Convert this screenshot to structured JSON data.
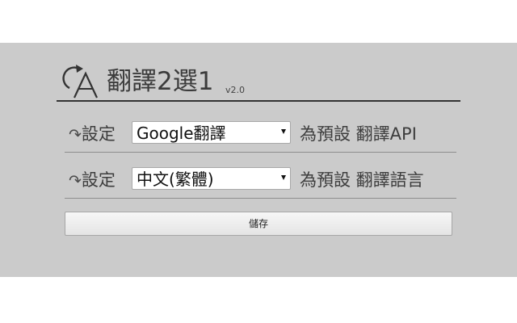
{
  "header": {
    "title": "翻譯2選1",
    "version": "v2.0",
    "logo_icon": "rotate-translate-logo"
  },
  "settings": [
    {
      "arrow": "↷",
      "prefix": "設定",
      "selected_value": "Google翻譯",
      "suffix": "為預設 翻譯API"
    },
    {
      "arrow": "↷",
      "prefix": "設定",
      "selected_value": "中文(繁體)",
      "suffix": "為預設 翻譯語言"
    }
  ],
  "save_button": {
    "label": "儲存"
  },
  "colors": {
    "panel_background": "#cbcbcb",
    "page_background": "#ffffff",
    "text": "#3d3d3d",
    "divider": "#8e8e8e"
  }
}
